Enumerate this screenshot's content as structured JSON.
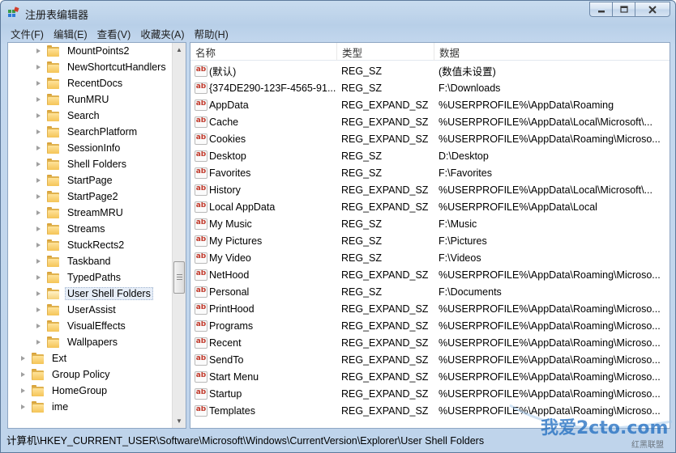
{
  "window": {
    "title": "注册表编辑器",
    "controls": {
      "minimize": "minimize-icon",
      "maximize": "maximize-icon",
      "close": "close-icon"
    }
  },
  "menu": [
    "文件(F)",
    "编辑(E)",
    "查看(V)",
    "收藏夹(A)",
    "帮助(H)"
  ],
  "tree": {
    "items": [
      {
        "label": "MountPoints2",
        "level": 2
      },
      {
        "label": "NewShortcutHandlers",
        "level": 2
      },
      {
        "label": "RecentDocs",
        "level": 2
      },
      {
        "label": "RunMRU",
        "level": 2
      },
      {
        "label": "Search",
        "level": 2
      },
      {
        "label": "SearchPlatform",
        "level": 2
      },
      {
        "label": "SessionInfo",
        "level": 2
      },
      {
        "label": "Shell Folders",
        "level": 2
      },
      {
        "label": "StartPage",
        "level": 2
      },
      {
        "label": "StartPage2",
        "level": 2
      },
      {
        "label": "StreamMRU",
        "level": 2
      },
      {
        "label": "Streams",
        "level": 2
      },
      {
        "label": "StuckRects2",
        "level": 2
      },
      {
        "label": "Taskband",
        "level": 2
      },
      {
        "label": "TypedPaths",
        "level": 2
      },
      {
        "label": "User Shell Folders",
        "level": 2,
        "selected": true
      },
      {
        "label": "UserAssist",
        "level": 2
      },
      {
        "label": "VisualEffects",
        "level": 2
      },
      {
        "label": "Wallpapers",
        "level": 2
      },
      {
        "label": "Ext",
        "level": 1
      },
      {
        "label": "Group Policy",
        "level": 1
      },
      {
        "label": "HomeGroup",
        "level": 1
      },
      {
        "label": "ime",
        "level": 1
      }
    ]
  },
  "list": {
    "columns": [
      "名称",
      "类型",
      "数据"
    ],
    "rows": [
      {
        "name": "(默认)",
        "type": "REG_SZ",
        "data": "(数值未设置)"
      },
      {
        "name": "{374DE290-123F-4565-91...",
        "type": "REG_SZ",
        "data": "F:\\Downloads"
      },
      {
        "name": "AppData",
        "type": "REG_EXPAND_SZ",
        "data": "%USERPROFILE%\\AppData\\Roaming"
      },
      {
        "name": "Cache",
        "type": "REG_EXPAND_SZ",
        "data": "%USERPROFILE%\\AppData\\Local\\Microsoft\\..."
      },
      {
        "name": "Cookies",
        "type": "REG_EXPAND_SZ",
        "data": "%USERPROFILE%\\AppData\\Roaming\\Microso..."
      },
      {
        "name": "Desktop",
        "type": "REG_SZ",
        "data": "D:\\Desktop"
      },
      {
        "name": "Favorites",
        "type": "REG_SZ",
        "data": "F:\\Favorites"
      },
      {
        "name": "History",
        "type": "REG_EXPAND_SZ",
        "data": "%USERPROFILE%\\AppData\\Local\\Microsoft\\..."
      },
      {
        "name": "Local AppData",
        "type": "REG_EXPAND_SZ",
        "data": "%USERPROFILE%\\AppData\\Local"
      },
      {
        "name": "My Music",
        "type": "REG_SZ",
        "data": "F:\\Music"
      },
      {
        "name": "My Pictures",
        "type": "REG_SZ",
        "data": "F:\\Pictures"
      },
      {
        "name": "My Video",
        "type": "REG_SZ",
        "data": "F:\\Videos"
      },
      {
        "name": "NetHood",
        "type": "REG_EXPAND_SZ",
        "data": "%USERPROFILE%\\AppData\\Roaming\\Microso..."
      },
      {
        "name": "Personal",
        "type": "REG_SZ",
        "data": "F:\\Documents"
      },
      {
        "name": "PrintHood",
        "type": "REG_EXPAND_SZ",
        "data": "%USERPROFILE%\\AppData\\Roaming\\Microso..."
      },
      {
        "name": "Programs",
        "type": "REG_EXPAND_SZ",
        "data": "%USERPROFILE%\\AppData\\Roaming\\Microso..."
      },
      {
        "name": "Recent",
        "type": "REG_EXPAND_SZ",
        "data": "%USERPROFILE%\\AppData\\Roaming\\Microso..."
      },
      {
        "name": "SendTo",
        "type": "REG_EXPAND_SZ",
        "data": "%USERPROFILE%\\AppData\\Roaming\\Microso..."
      },
      {
        "name": "Start Menu",
        "type": "REG_EXPAND_SZ",
        "data": "%USERPROFILE%\\AppData\\Roaming\\Microso..."
      },
      {
        "name": "Startup",
        "type": "REG_EXPAND_SZ",
        "data": "%USERPROFILE%\\AppData\\Roaming\\Microso..."
      },
      {
        "name": "Templates",
        "type": "REG_EXPAND_SZ",
        "data": "%USERPROFILE%\\AppData\\Roaming\\Microso..."
      }
    ]
  },
  "status": {
    "path": "计算机\\HKEY_CURRENT_USER\\Software\\Microsoft\\Windows\\CurrentVersion\\Explorer\\User Shell Folders"
  },
  "watermark": {
    "text": "我爱2cto.com",
    "sub": "红黑联盟"
  },
  "colors": {
    "accent": "#c0392b",
    "frame": "#bfd4eb"
  }
}
